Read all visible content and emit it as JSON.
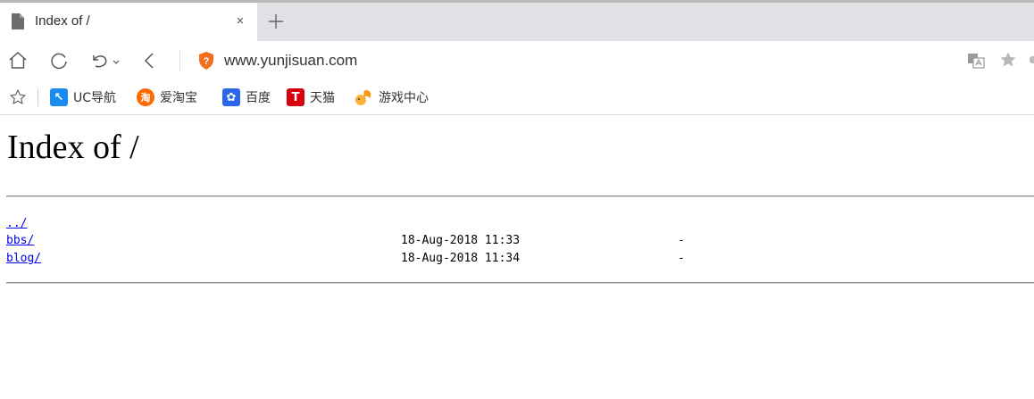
{
  "browser": {
    "tab": {
      "title": "Index of /",
      "close_icon": "×"
    },
    "url": "www.yunjisuan.com",
    "bookmarks": [
      {
        "label": "UC导航",
        "icon": "uc-nav-icon",
        "icon_text": "↖",
        "color": "#1a8cf0"
      },
      {
        "label": "爱淘宝",
        "icon": "aitaobao-icon",
        "icon_text": "淘",
        "color": "#ff6a00"
      },
      {
        "label": "百度",
        "icon": "baidu-paw-icon",
        "icon_text": "✿",
        "color": "#2b67e8"
      },
      {
        "label": "天猫",
        "icon": "tmall-icon",
        "icon_text": "T",
        "color": "#d9000e"
      },
      {
        "label": "游戏中心",
        "icon": "game-center-icon",
        "icon_text": "",
        "color": "#f39a1b"
      }
    ]
  },
  "page": {
    "heading": "Index of /",
    "entries": [
      {
        "name": "../",
        "date": "",
        "size": ""
      },
      {
        "name": "bbs/",
        "date": "18-Aug-2018 11:33",
        "size": "-"
      },
      {
        "name": "blog/",
        "date": "18-Aug-2018 11:34",
        "size": "-"
      }
    ]
  }
}
